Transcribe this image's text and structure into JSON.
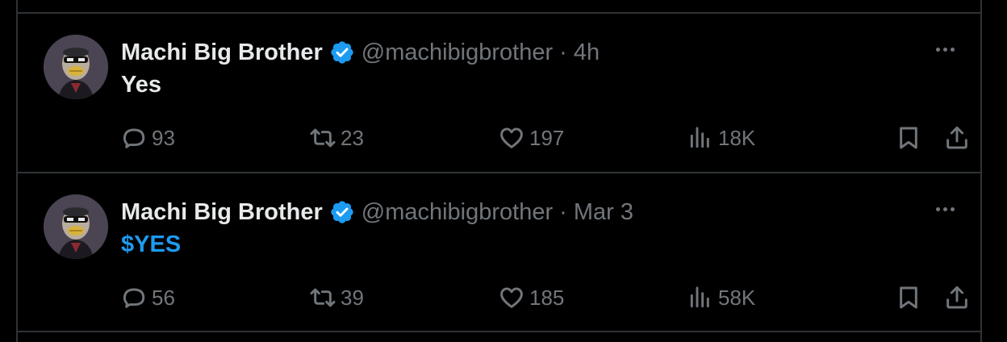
{
  "colors": {
    "background": "#000000",
    "text": "#e7e9ea",
    "muted": "#71767b",
    "accent": "#1d9bf0",
    "border": "#2f3336"
  },
  "tweets": [
    {
      "author": "Machi Big Brother",
      "handle": "@machibigbrother",
      "separator": "·",
      "time": "4h",
      "text": "Yes",
      "text_is_link": false,
      "replies": "93",
      "reposts": "23",
      "likes": "197",
      "views": "18K"
    },
    {
      "author": "Machi Big Brother",
      "handle": "@machibigbrother",
      "separator": "·",
      "time": "Mar 3",
      "text": "$YES",
      "text_is_link": true,
      "replies": "56",
      "reposts": "39",
      "likes": "185",
      "views": "58K"
    }
  ],
  "icons": [
    "verified-badge-icon",
    "more-options-icon",
    "reply-icon",
    "repost-icon",
    "like-icon",
    "views-icon",
    "bookmark-icon",
    "share-icon"
  ]
}
